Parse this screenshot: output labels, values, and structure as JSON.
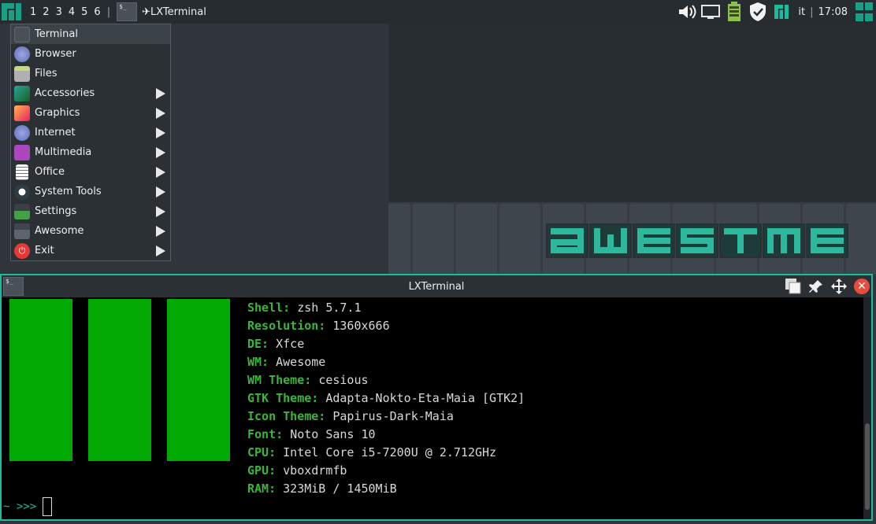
{
  "panel": {
    "tags": [
      "1",
      "2",
      "3",
      "4",
      "5",
      "6"
    ],
    "separator": "|",
    "task_label": "✈LXTerminal",
    "keyboard_layout": "it",
    "time": "17:08"
  },
  "wallpaper": {
    "word": "AWESOME",
    "accent": "#2db89e"
  },
  "menu": {
    "items": [
      {
        "label": "Terminal",
        "icon": "terminal-icon",
        "submenu": false
      },
      {
        "label": "Browser",
        "icon": "browser-icon",
        "submenu": false
      },
      {
        "label": "Files",
        "icon": "files-icon",
        "submenu": false
      },
      {
        "label": "Accessories",
        "icon": "accessories-icon",
        "submenu": true
      },
      {
        "label": "Graphics",
        "icon": "graphics-icon",
        "submenu": true
      },
      {
        "label": "Internet",
        "icon": "internet-icon",
        "submenu": true
      },
      {
        "label": "Multimedia",
        "icon": "multimedia-icon",
        "submenu": true
      },
      {
        "label": "Office",
        "icon": "office-icon",
        "submenu": true
      },
      {
        "label": "System Tools",
        "icon": "system-tools-icon",
        "submenu": true
      },
      {
        "label": "Settings",
        "icon": "settings-icon",
        "submenu": true
      },
      {
        "label": "Awesome",
        "icon": "awesome-icon",
        "submenu": true
      },
      {
        "label": "Exit",
        "icon": "exit-icon",
        "submenu": true
      }
    ]
  },
  "terminal": {
    "title": "LXTerminal",
    "bar_color": "#00aa00",
    "info": [
      {
        "key": "Shell:",
        "value": "zsh 5.7.1"
      },
      {
        "key": "Resolution:",
        "value": "1360x666"
      },
      {
        "key": "DE:",
        "value": "Xfce"
      },
      {
        "key": "WM:",
        "value": "Awesome"
      },
      {
        "key": "WM Theme:",
        "value": "cesious"
      },
      {
        "key": "GTK Theme:",
        "value": "Adapta-Nokto-Eta-Maia [GTK2]"
      },
      {
        "key": "Icon Theme:",
        "value": "Papirus-Dark-Maia"
      },
      {
        "key": "Font:",
        "value": "Noto Sans 10"
      },
      {
        "key": "CPU:",
        "value": "Intel Core i5-7200U @ 2.712GHz"
      },
      {
        "key": "GPU:",
        "value": "vboxdrmfb"
      },
      {
        "key": "RAM:",
        "value": "323MiB / 1450MiB"
      }
    ],
    "prompt": "~ >>>"
  }
}
